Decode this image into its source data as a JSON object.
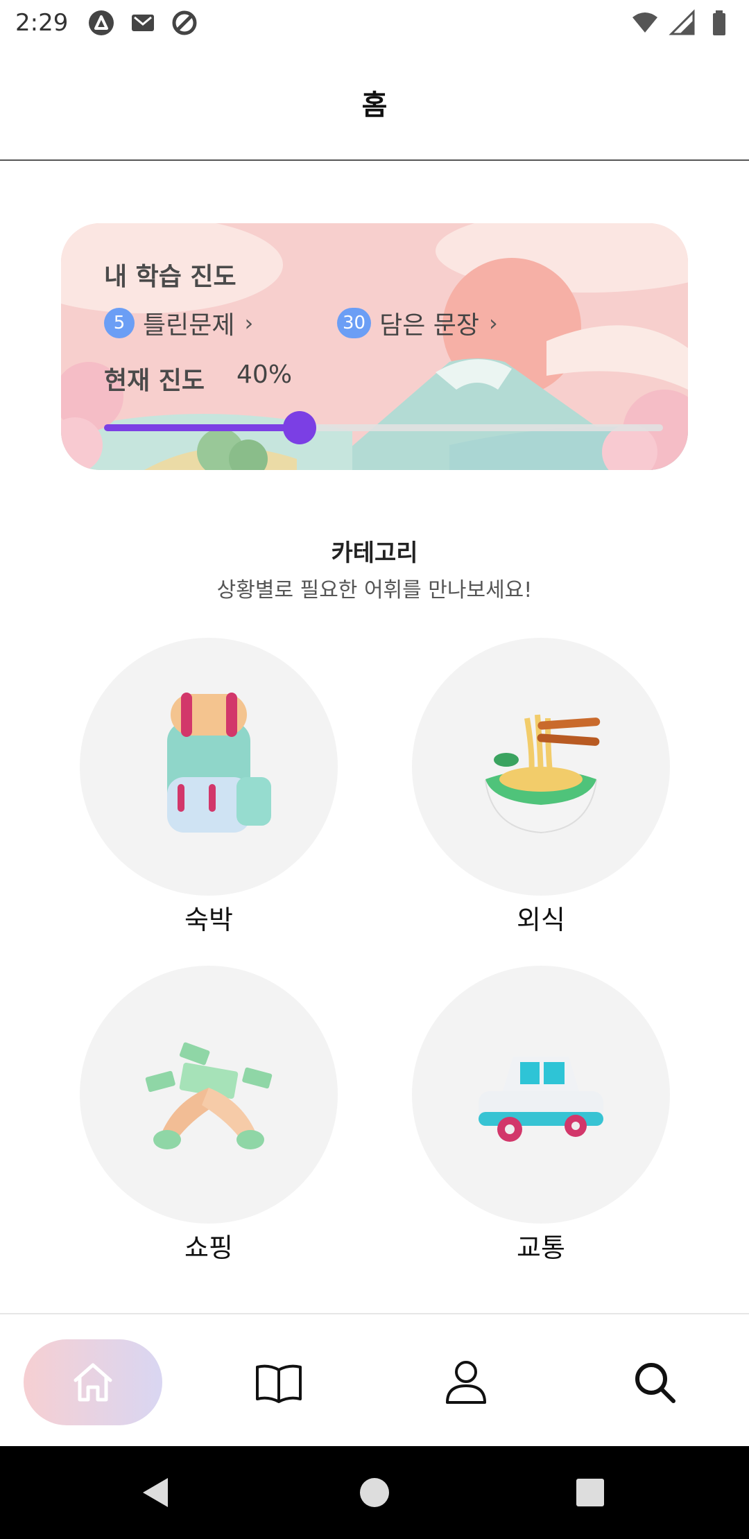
{
  "status_bar": {
    "time": "2:29",
    "left_icons": [
      "app-a-icon",
      "gmail-icon",
      "sync-icon"
    ],
    "right_icons": [
      "wifi-icon",
      "signal-icon",
      "battery-icon"
    ]
  },
  "app_bar": {
    "title": "홈"
  },
  "progress_card": {
    "title": "내 학습 진도",
    "wrong": {
      "count": "5",
      "label": "틀린문제"
    },
    "saved": {
      "count": "30",
      "label": "담은 문장"
    },
    "current_label": "현재 진도",
    "current_value": "40%",
    "progress_fraction": 0.35,
    "accent_color": "#7b3fe4",
    "badge_color": "#6b9ef5"
  },
  "categories": {
    "title": "카테고리",
    "subtitle": "상황별로 필요한 어휘를 만나보세요!",
    "items": [
      {
        "label": "숙박",
        "icon": "backpack-icon"
      },
      {
        "label": "외식",
        "icon": "noodle-bowl-icon"
      },
      {
        "label": "쇼핑",
        "icon": "money-hands-icon"
      },
      {
        "label": "교통",
        "icon": "car-icon"
      }
    ]
  },
  "bottom_nav": {
    "items": [
      {
        "name": "home",
        "icon": "home-icon",
        "active": true
      },
      {
        "name": "book",
        "icon": "book-icon",
        "active": false
      },
      {
        "name": "profile",
        "icon": "user-icon",
        "active": false
      },
      {
        "name": "search",
        "icon": "search-icon",
        "active": false
      }
    ]
  }
}
